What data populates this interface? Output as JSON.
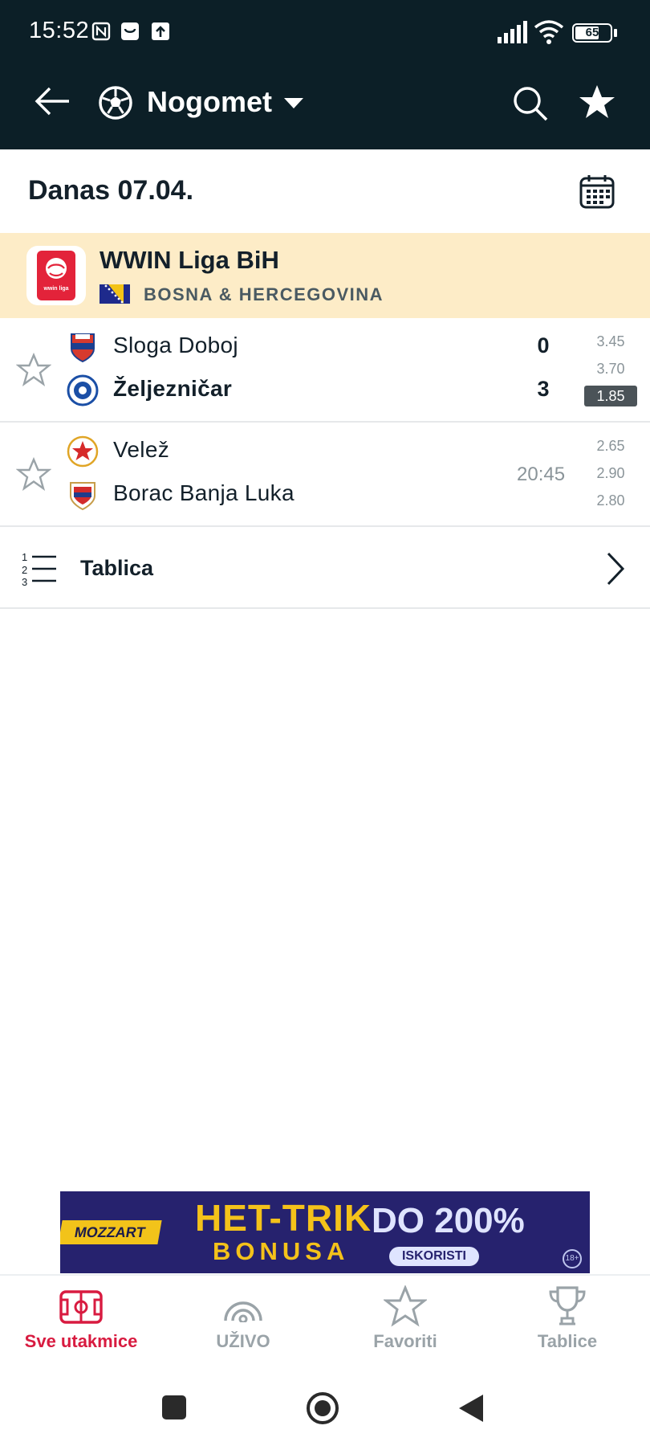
{
  "status_bar": {
    "time": "15:52",
    "battery": "65"
  },
  "app_bar": {
    "sport": "Nogomet"
  },
  "date_row": {
    "label": "Danas 07.04."
  },
  "league": {
    "name": "WWIN Liga BiH",
    "country": "BOSNA & HERCEGOVINA",
    "logo_text": "wwin liga"
  },
  "matches": [
    {
      "home": "Sloga Doboj",
      "away": "Željezničar",
      "home_score": "0",
      "away_score": "3",
      "odds": [
        "3.45",
        "3.70",
        "1.85"
      ]
    },
    {
      "home": "Velež",
      "away": "Borac Banja Luka",
      "time": "20:45",
      "odds": [
        "2.65",
        "2.90",
        "2.80"
      ]
    }
  ],
  "tablica": {
    "label": "Tablica"
  },
  "banner": {
    "brand": "MOZZART",
    "headline": "HET-TRIK",
    "subline": "BONUSA",
    "offer": "DO 200%",
    "cta": "ISKORISTI",
    "age": "18+"
  },
  "bottom_nav": {
    "items": [
      {
        "label": "Sve utakmice"
      },
      {
        "label": "UŽIVO"
      },
      {
        "label": "Favoriti"
      },
      {
        "label": "Tablice"
      }
    ]
  },
  "colors": {
    "topbar": "#0c1f27",
    "accent": "#d81b40",
    "league_bg": "#fdecc7",
    "odd_highlight": "#4b5358"
  }
}
